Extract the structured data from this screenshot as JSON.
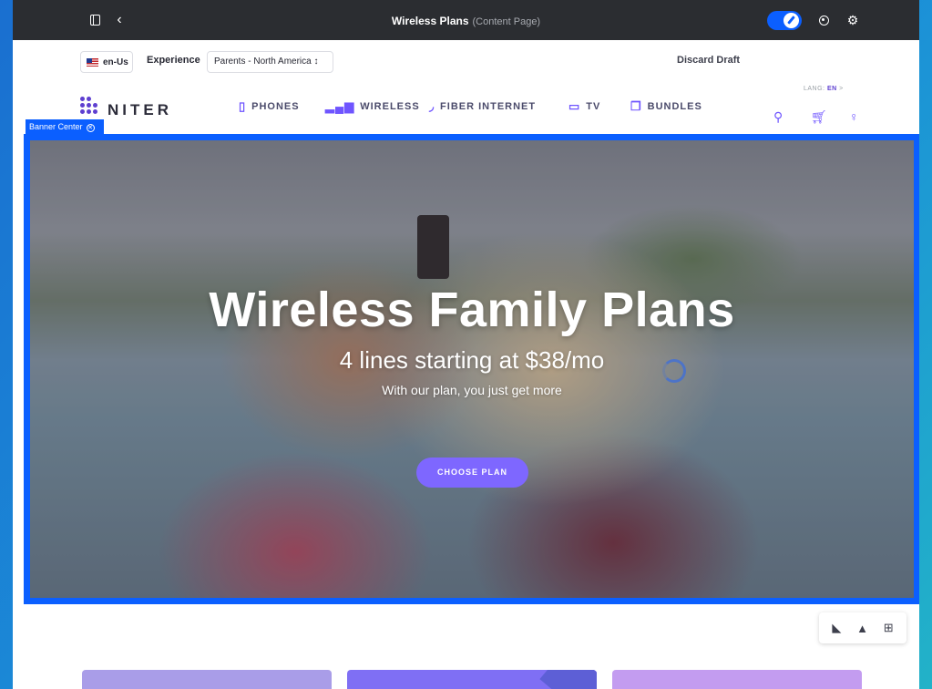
{
  "topbar": {
    "page_title": "Wireless Plans",
    "page_type": "(Content Page)"
  },
  "experience_bar": {
    "locale": "en-Us",
    "experience_label": "Experience",
    "experience_value": "Parents - North America ↕",
    "discard_label": "Discard Draft"
  },
  "site": {
    "logo_text": "NITER",
    "nav": [
      {
        "label": "PHONES",
        "icon": "phone-icon"
      },
      {
        "label": "WIRELESS",
        "icon": "signal-bars-icon"
      },
      {
        "label": "FIBER INTERNET",
        "icon": "wifi-icon"
      },
      {
        "label": "TV",
        "icon": "tv-icon"
      },
      {
        "label": "BUNDLES",
        "icon": "bundles-icon"
      }
    ],
    "lang_label": "LANG:",
    "lang_value": "EN",
    "lang_arrow": ">"
  },
  "banner": {
    "tag_label": "Banner Center",
    "title": "Wireless Family Plans",
    "subtitle": "4 lines starting at $38/mo",
    "tagline": "With our plan, you just get more",
    "cta_label": "CHOOSE PLAN"
  },
  "colors": {
    "accent": "#0b5fff",
    "brand": "#6f55ff",
    "cta": "#7e67ff",
    "card_1": "#a99de8",
    "card_2": "#7f6ff4",
    "card_3": "#c39cf0"
  }
}
